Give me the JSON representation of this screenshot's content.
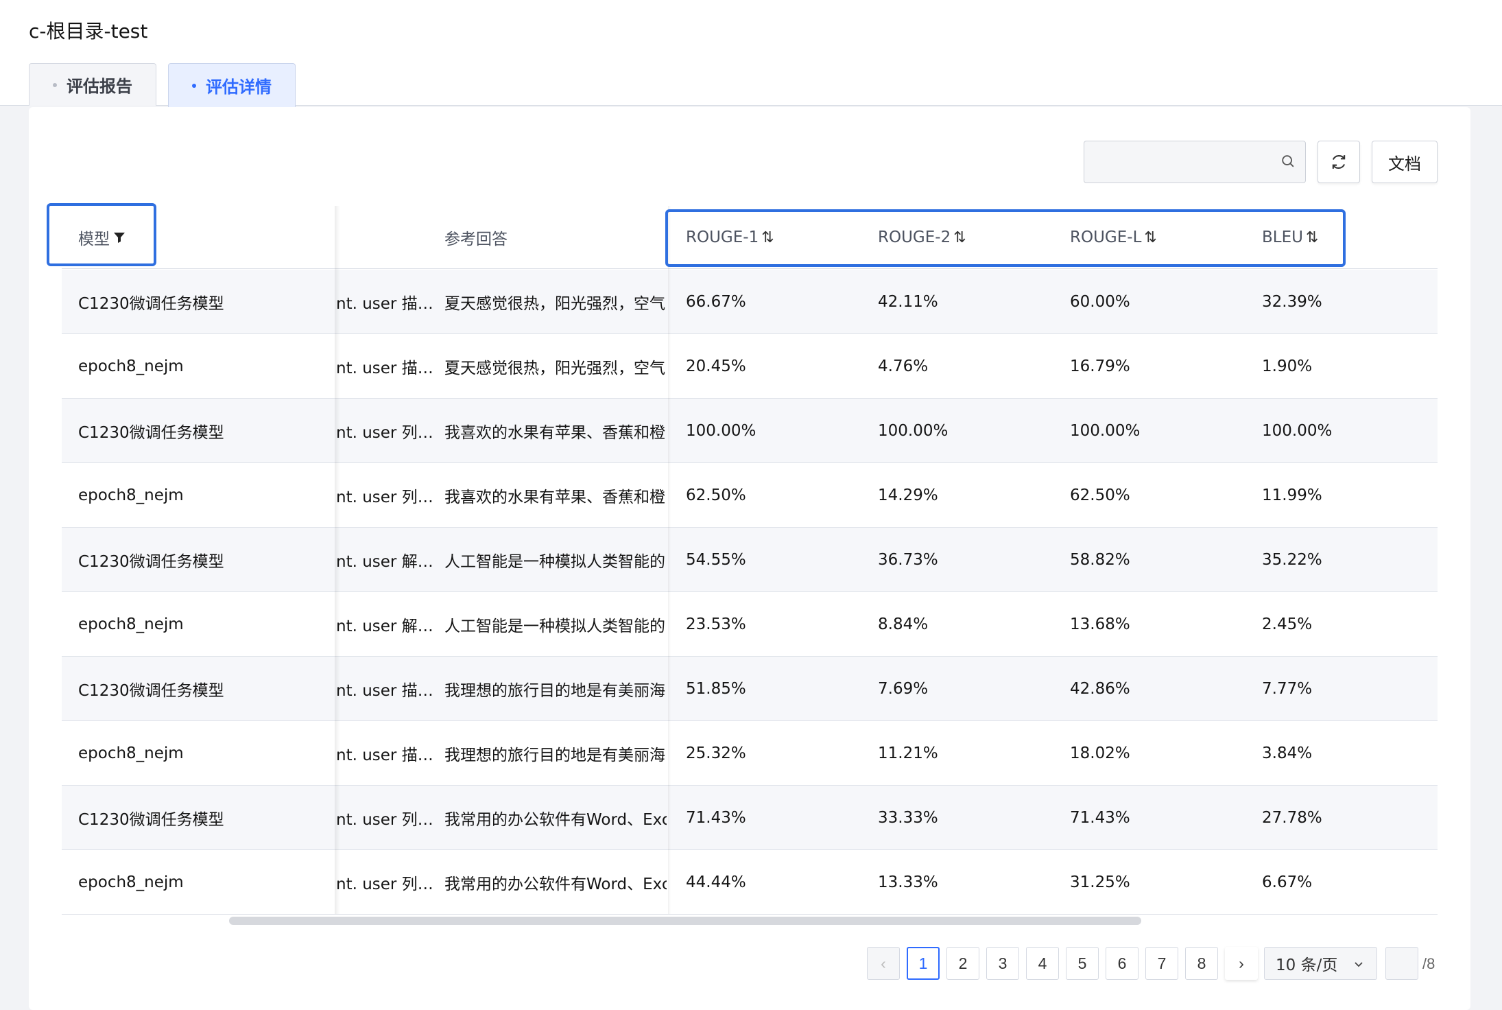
{
  "page": {
    "title": "c-根目录-test"
  },
  "tabs": [
    {
      "label": "评估报告",
      "active": false
    },
    {
      "label": "评估详情",
      "active": true
    }
  ],
  "toolbar": {
    "search_placeholder": "",
    "refresh_icon": "refresh-icon",
    "doc_label": "文档"
  },
  "table": {
    "headers": {
      "model": "模型",
      "input": "",
      "reference": "参考回答",
      "rouge1": "ROUGE-1",
      "rouge2": "ROUGE-2",
      "rougel": "ROUGE-L",
      "bleu": "BLEU"
    },
    "rows": [
      {
        "model": "C1230微调任务模型",
        "input": "nt. user 描…",
        "reference": "夏天感觉很热，阳光强烈，空气",
        "rouge1": "66.67%",
        "rouge2": "42.11%",
        "rougel": "60.00%",
        "bleu": "32.39%"
      },
      {
        "model": "epoch8_nejm",
        "input": "nt. user 描…",
        "reference": "夏天感觉很热，阳光强烈，空气",
        "rouge1": "20.45%",
        "rouge2": "4.76%",
        "rougel": "16.79%",
        "bleu": "1.90%"
      },
      {
        "model": "C1230微调任务模型",
        "input": "nt. user 列…",
        "reference": "我喜欢的水果有苹果、香蕉和橙",
        "rouge1": "100.00%",
        "rouge2": "100.00%",
        "rougel": "100.00%",
        "bleu": "100.00%"
      },
      {
        "model": "epoch8_nejm",
        "input": "nt. user 列…",
        "reference": "我喜欢的水果有苹果、香蕉和橙",
        "rouge1": "62.50%",
        "rouge2": "14.29%",
        "rougel": "62.50%",
        "bleu": "11.99%"
      },
      {
        "model": "C1230微调任务模型",
        "input": "nt. user 解…",
        "reference": "人工智能是一种模拟人类智能的",
        "rouge1": "54.55%",
        "rouge2": "36.73%",
        "rougel": "58.82%",
        "bleu": "35.22%"
      },
      {
        "model": "epoch8_nejm",
        "input": "nt. user 解…",
        "reference": "人工智能是一种模拟人类智能的",
        "rouge1": "23.53%",
        "rouge2": "8.84%",
        "rougel": "13.68%",
        "bleu": "2.45%"
      },
      {
        "model": "C1230微调任务模型",
        "input": "nt. user 描…",
        "reference": "我理想的旅行目的地是有美丽海",
        "rouge1": "51.85%",
        "rouge2": "7.69%",
        "rougel": "42.86%",
        "bleu": "7.77%"
      },
      {
        "model": "epoch8_nejm",
        "input": "nt. user 描…",
        "reference": "我理想的旅行目的地是有美丽海",
        "rouge1": "25.32%",
        "rouge2": "11.21%",
        "rougel": "18.02%",
        "bleu": "3.84%"
      },
      {
        "model": "C1230微调任务模型",
        "input": "nt. user 列…",
        "reference": "我常用的办公软件有Word、Exc",
        "rouge1": "71.43%",
        "rouge2": "33.33%",
        "rougel": "71.43%",
        "bleu": "27.78%"
      },
      {
        "model": "epoch8_nejm",
        "input": "nt. user 列…",
        "reference": "我常用的办公软件有Word、Exc",
        "rouge1": "44.44%",
        "rouge2": "13.33%",
        "rougel": "31.25%",
        "bleu": "6.67%"
      }
    ]
  },
  "pagination": {
    "pages": [
      "1",
      "2",
      "3",
      "4",
      "5",
      "6",
      "7",
      "8"
    ],
    "current": "1",
    "prev": "‹",
    "next": "›",
    "page_size": "10 条/页",
    "total_suffix": "/8"
  }
}
